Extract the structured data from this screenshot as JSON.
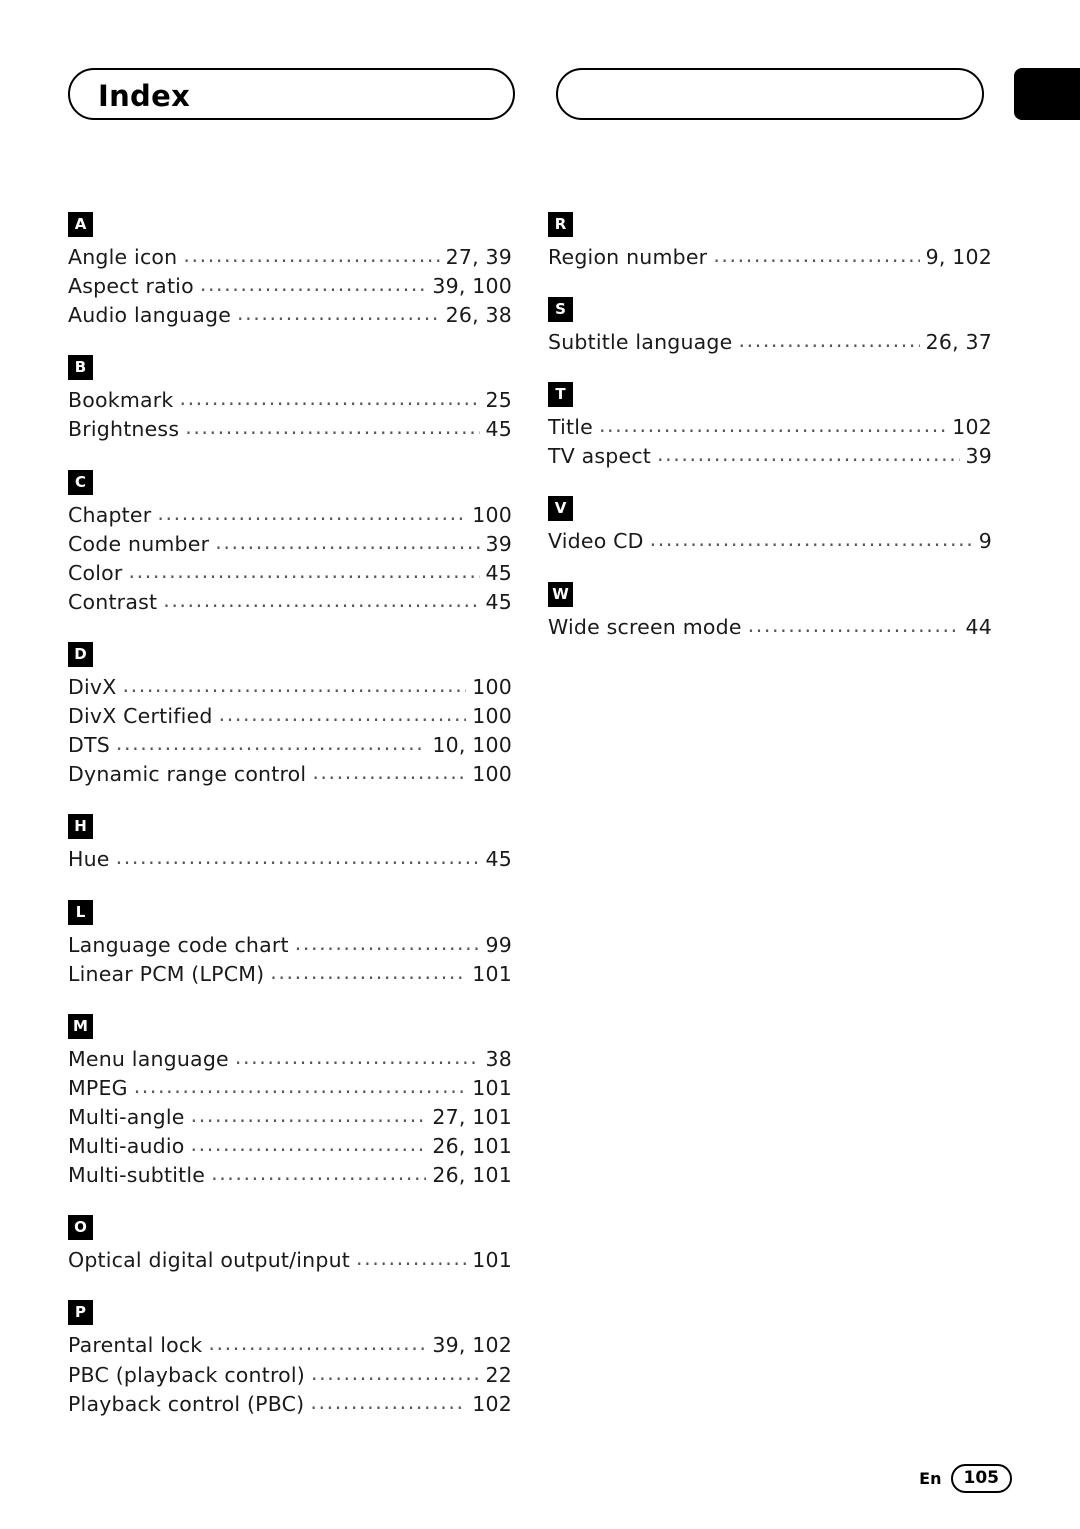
{
  "header": {
    "title": "Index"
  },
  "footer": {
    "language": "En",
    "page": "105"
  },
  "columns": [
    {
      "side": "left",
      "groups": [
        {
          "letter": "A",
          "entries": [
            {
              "term": "Angle icon",
              "pages": "27, 39"
            },
            {
              "term": "Aspect ratio",
              "pages": "39, 100"
            },
            {
              "term": "Audio language",
              "pages": "26, 38"
            }
          ]
        },
        {
          "letter": "B",
          "entries": [
            {
              "term": "Bookmark",
              "pages": "25"
            },
            {
              "term": "Brightness",
              "pages": "45"
            }
          ]
        },
        {
          "letter": "C",
          "entries": [
            {
              "term": "Chapter",
              "pages": "100"
            },
            {
              "term": "Code number",
              "pages": "39"
            },
            {
              "term": "Color",
              "pages": "45"
            },
            {
              "term": "Contrast",
              "pages": "45"
            }
          ]
        },
        {
          "letter": "D",
          "entries": [
            {
              "term": "DivX",
              "pages": "100"
            },
            {
              "term": "DivX Certified",
              "pages": "100"
            },
            {
              "term": "DTS",
              "pages": "10, 100"
            },
            {
              "term": "Dynamic range control",
              "pages": "100"
            }
          ]
        },
        {
          "letter": "H",
          "entries": [
            {
              "term": "Hue",
              "pages": "45"
            }
          ]
        },
        {
          "letter": "L",
          "entries": [
            {
              "term": "Language code chart",
              "pages": "99"
            },
            {
              "term": "Linear PCM (LPCM)",
              "pages": "101"
            }
          ]
        },
        {
          "letter": "M",
          "entries": [
            {
              "term": "Menu language",
              "pages": "38"
            },
            {
              "term": "MPEG",
              "pages": "101"
            },
            {
              "term": "Multi-angle",
              "pages": "27, 101"
            },
            {
              "term": "Multi-audio",
              "pages": "26, 101"
            },
            {
              "term": "Multi-subtitle",
              "pages": "26, 101"
            }
          ]
        },
        {
          "letter": "O",
          "entries": [
            {
              "term": "Optical digital output/input",
              "pages": "101"
            }
          ]
        },
        {
          "letter": "P",
          "entries": [
            {
              "term": "Parental lock",
              "pages": "39, 102"
            },
            {
              "term": "PBC (playback control)",
              "pages": "22"
            },
            {
              "term": "Playback control (PBC)",
              "pages": "102"
            }
          ]
        }
      ]
    },
    {
      "side": "right",
      "groups": [
        {
          "letter": "R",
          "entries": [
            {
              "term": "Region number",
              "pages": "9, 102"
            }
          ]
        },
        {
          "letter": "S",
          "entries": [
            {
              "term": "Subtitle language",
              "pages": "26, 37"
            }
          ]
        },
        {
          "letter": "T",
          "entries": [
            {
              "term": "Title",
              "pages": "102"
            },
            {
              "term": "TV aspect",
              "pages": "39"
            }
          ]
        },
        {
          "letter": "V",
          "entries": [
            {
              "term": "Video CD",
              "pages": "9"
            }
          ]
        },
        {
          "letter": "W",
          "entries": [
            {
              "term": "Wide screen mode",
              "pages": "44"
            }
          ]
        }
      ]
    }
  ]
}
